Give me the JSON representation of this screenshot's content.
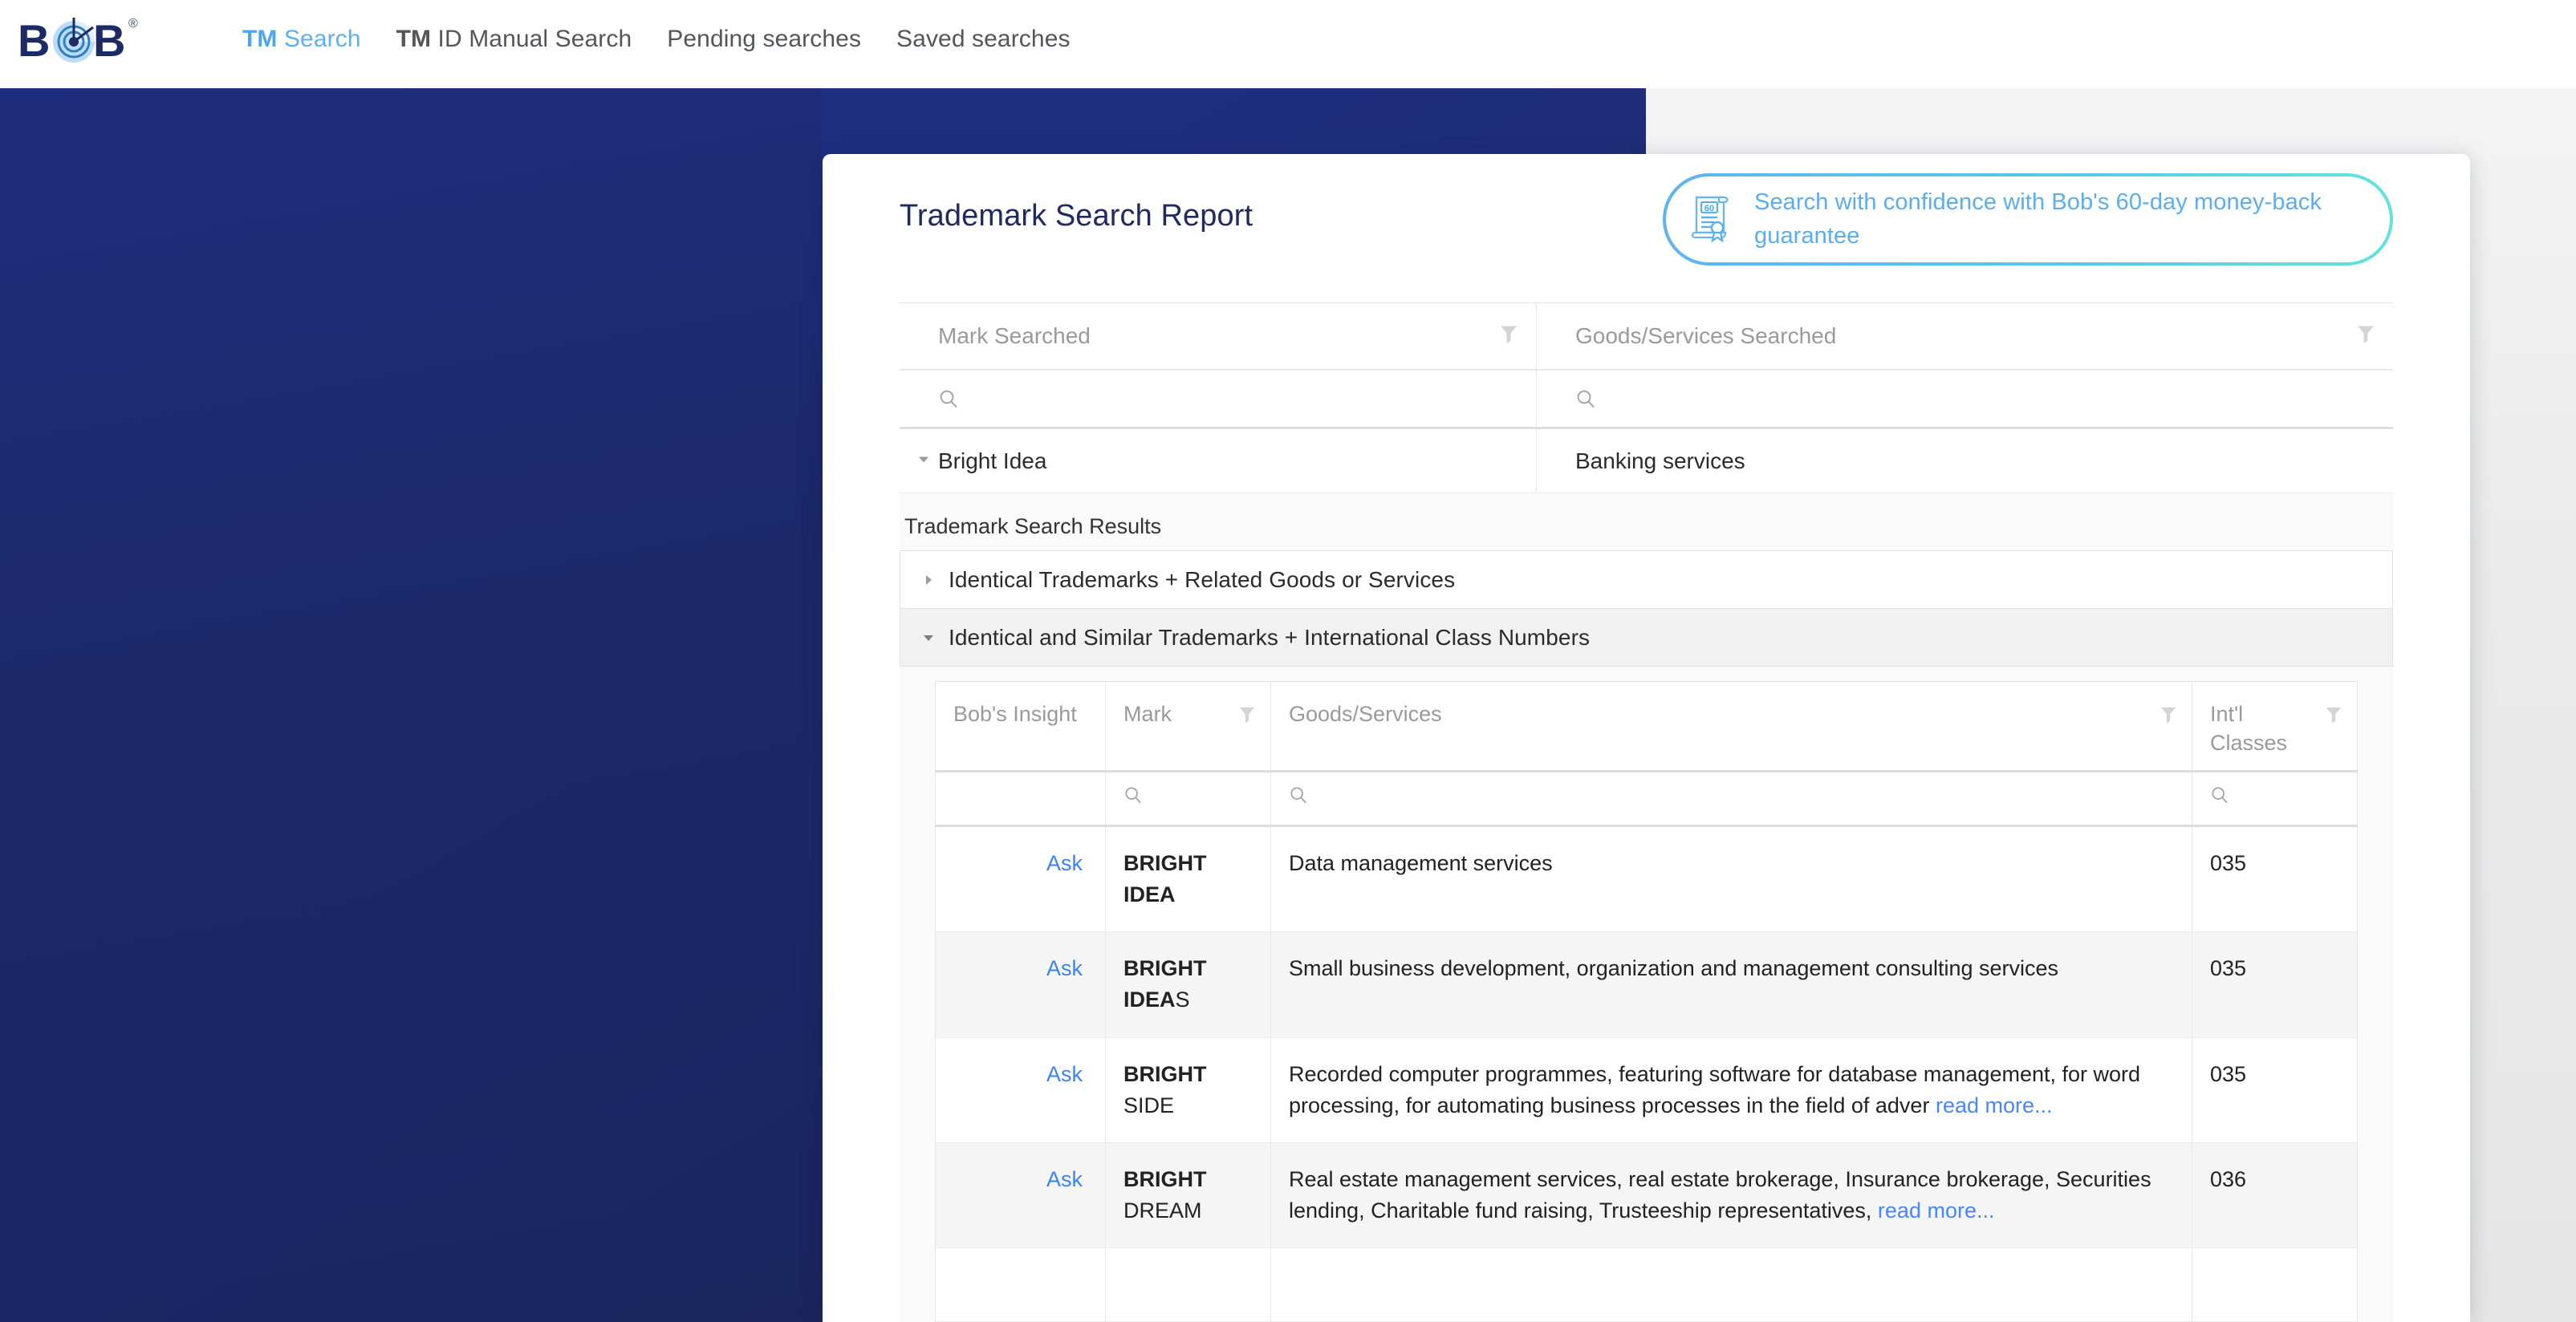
{
  "brand": {
    "logo_text": "BOB",
    "logo_mark": "bob-radar-logo",
    "registered_symbol": "®"
  },
  "nav": {
    "items": [
      {
        "prefix": "TM",
        "label": " Search",
        "active": true
      },
      {
        "prefix": "TM",
        "label": " ID Manual Search",
        "active": false
      },
      {
        "prefix": "",
        "label": "Pending searches",
        "active": false
      },
      {
        "prefix": "",
        "label": "Saved searches",
        "active": false
      }
    ]
  },
  "report": {
    "title": "Trademark Search Report",
    "guarantee": {
      "icon": "certificate-60-day-icon",
      "badge_number": "60",
      "text": "Search with confidence with Bob's 60-day money-back guarantee"
    }
  },
  "searched_table": {
    "headers": [
      "Mark Searched",
      "Goods/Services Searched"
    ],
    "filter_placeholder": "",
    "rows": [
      {
        "mark": "Bright Idea",
        "goods": "Banking services",
        "expanded": true
      }
    ]
  },
  "results": {
    "heading": "Trademark Search Results",
    "sections": [
      {
        "label": "Identical Trademarks + Related Goods or Services",
        "expanded": false
      },
      {
        "label": "Identical and Similar Trademarks + International Class Numbers",
        "expanded": true
      }
    ],
    "table": {
      "headers": {
        "insight": "Bob's Insight",
        "mark": "Mark",
        "goods": "Goods/Services",
        "classes": "Int'l Classes"
      },
      "rows": [
        {
          "ask": "Ask",
          "mark_bold": "BRIGHT",
          "mark_rest": " IDEA",
          "goods": "Data management services",
          "read_more": "",
          "classes": "035"
        },
        {
          "ask": "Ask",
          "mark_bold": "BRIGHT IDEA",
          "mark_rest": "S",
          "goods": "Small business development, organization and management consulting services",
          "read_more": "",
          "classes": "035"
        },
        {
          "ask": "Ask",
          "mark_bold": "BRIGHT",
          "mark_rest": " SIDE",
          "goods": "Recorded computer programmes, featuring software for database management, for word processing, for automating business processes in the field of adver ",
          "read_more": "read more...",
          "classes": "035"
        },
        {
          "ask": "Ask",
          "mark_bold": "BRIGHT",
          "mark_rest": " DREAM",
          "goods": "Real estate management services, real estate brokerage, Insurance brokerage, Securities lending, Charitable fund raising, Trusteeship representatives, ",
          "read_more": "read more...",
          "classes": "036"
        }
      ]
    }
  },
  "colors": {
    "brand_navy": "#1e2e7e",
    "accent_blue": "#5aaef0",
    "link_blue": "#3b82f6",
    "title_navy": "#1f2a63",
    "page_gray": "#ececec"
  }
}
